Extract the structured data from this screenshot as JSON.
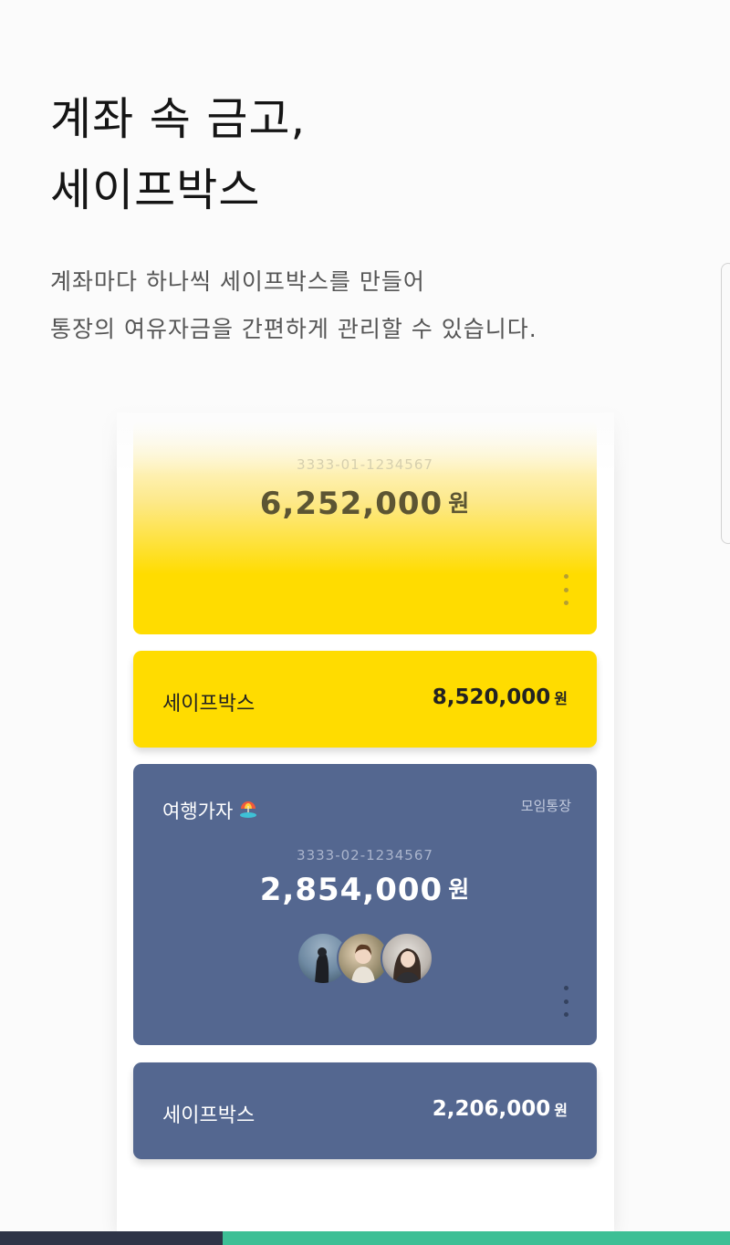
{
  "hero": {
    "title_line1": "계좌 속 금고,",
    "title_line2": "세이프박스",
    "desc_line1": "계좌마다 하나씩 세이프박스를 만들어",
    "desc_line2": "통장의 여유자금을 간편하게 관리할 수 있습니다."
  },
  "main_account": {
    "account_number": "3333-01-1234567",
    "balance": "6,252,000",
    "unit": "원"
  },
  "main_safebox": {
    "label": "세이프박스",
    "amount": "8,520,000",
    "unit": "원"
  },
  "group_account": {
    "name": "여행가자",
    "icon": "beach-umbrella-icon",
    "type_label": "모임통장",
    "account_number": "3333-02-1234567",
    "balance": "2,854,000",
    "unit": "원",
    "member_avatars": [
      "member-avatar-1",
      "member-avatar-2",
      "member-avatar-3"
    ]
  },
  "group_safebox": {
    "label": "세이프박스",
    "amount": "2,206,000",
    "unit": "원"
  },
  "colors": {
    "brand_yellow": "#ffdc00",
    "group_blue": "#546790",
    "bottom_dark": "#2e3447",
    "bottom_green": "#3dbf95"
  }
}
